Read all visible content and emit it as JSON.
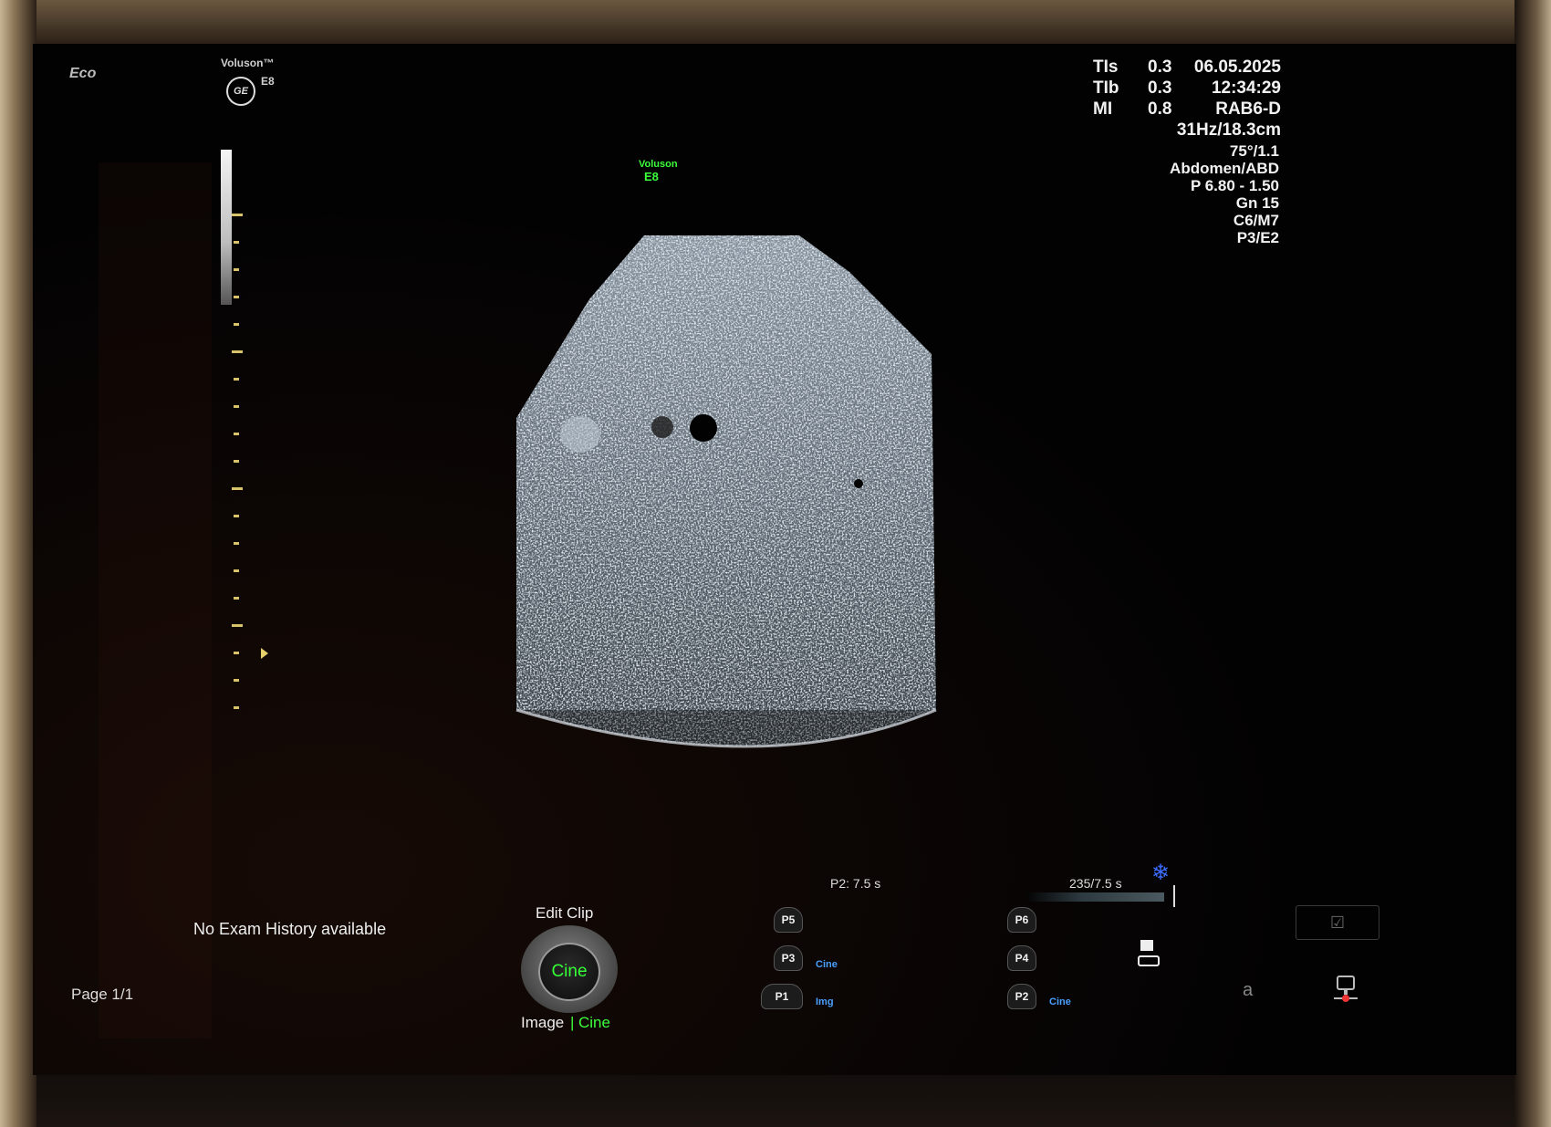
{
  "brand": {
    "small_logo": "Eco",
    "product": "Voluson™",
    "model": "E8",
    "ge": "GE"
  },
  "overlay": {
    "product": "Voluson",
    "model": "E8"
  },
  "index": {
    "tis_label": "TIs",
    "tis_value": "0.3",
    "tib_label": "TIb",
    "tib_value": "0.3",
    "mi_label": "MI",
    "mi_value": "0.8"
  },
  "exam": {
    "date": "06.05.2025",
    "time": "12:34:29",
    "probe": "RAB6-D",
    "rate_depth": "31Hz/18.3cm",
    "angle": "75°/1.1",
    "preset": "Abdomen/ABD",
    "power": "P 6.80 - 1.50",
    "gain": "Gn  15",
    "c_m": "C6/M7",
    "p_e": "P3/E2"
  },
  "cine": {
    "left_label": "P2:  7.5 s",
    "right_label": "235/7.5 s",
    "progress": 1.0,
    "freeze_icon": "snowflake-icon"
  },
  "bottom": {
    "history": "No Exam History available",
    "page": "Page 1/1",
    "edit_clip": "Edit Clip",
    "knob_label": "Cine",
    "image_label": "Image",
    "divider": "|",
    "cine_label": "Cine",
    "keyboard_hint": "a"
  },
  "presets": [
    {
      "key": "P5",
      "tag": ""
    },
    {
      "key": "P3",
      "tag": "Cine"
    },
    {
      "key": "P1",
      "tag": "Img"
    },
    {
      "key": "P6",
      "tag": ""
    },
    {
      "key": "P4",
      "tag": ""
    },
    {
      "key": "P2",
      "tag": "Cine"
    }
  ],
  "colors": {
    "accent_green": "#3cff3c",
    "preset_blue": "#4aa0ff",
    "scale_yellow": "#d8c36a",
    "freeze_blue": "#3b6cff"
  }
}
